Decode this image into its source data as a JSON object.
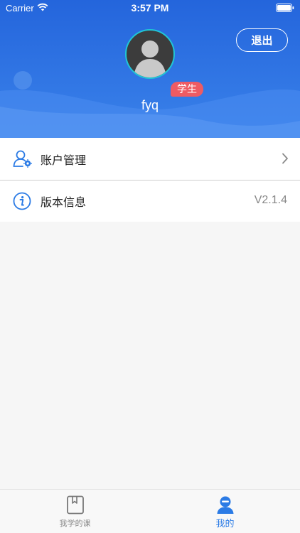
{
  "status_bar": {
    "carrier": "Carrier",
    "time": "3:57 PM"
  },
  "header": {
    "logout_label": "退出",
    "role_badge": "学生",
    "username": "fyq"
  },
  "menu": {
    "items": [
      {
        "label": "账户管理",
        "icon": "user-settings-icon",
        "trailing": "chevron-right-icon"
      },
      {
        "label": "版本信息",
        "icon": "info-icon",
        "value": "V2.1.4"
      }
    ]
  },
  "tabbar": {
    "tabs": [
      {
        "label": "我学的课",
        "icon": "bookmark-book-icon",
        "active": false
      },
      {
        "label": "我的",
        "icon": "profile-icon",
        "active": true
      }
    ]
  },
  "colors": {
    "header_blue": "#2a6fe0",
    "badge_red": "#ee5b63",
    "accent": "#2b7be5"
  }
}
